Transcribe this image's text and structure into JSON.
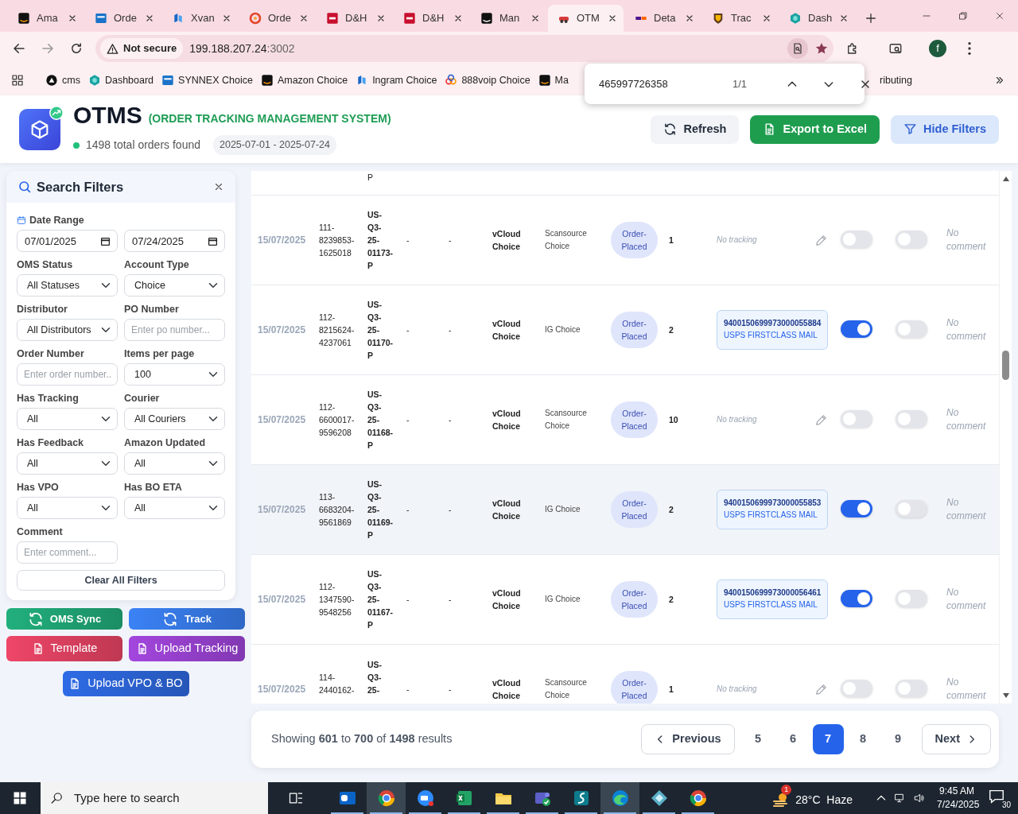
{
  "browser": {
    "tabs": [
      {
        "title": "Ama",
        "selected": false
      },
      {
        "title": "Orde",
        "selected": false
      },
      {
        "title": "Xvan",
        "selected": false
      },
      {
        "title": "Orde",
        "selected": false
      },
      {
        "title": "D&H",
        "selected": false
      },
      {
        "title": "D&H",
        "selected": false
      },
      {
        "title": "Man",
        "selected": false
      },
      {
        "title": "OTM",
        "selected": true
      },
      {
        "title": "Deta",
        "selected": false
      },
      {
        "title": "Trac",
        "selected": false
      },
      {
        "title": "Dash",
        "selected": false
      }
    ],
    "address": {
      "security": "Not secure",
      "host": "199.188.207.24",
      "port": ":3002"
    },
    "profile_initial": "f",
    "bookmarks": [
      {
        "title": "cms"
      },
      {
        "title": "Dashboard"
      },
      {
        "title": "SYNNEX Choice"
      },
      {
        "title": "Amazon Choice"
      },
      {
        "title": "Ingram Choice"
      },
      {
        "title": "888voip Choice"
      },
      {
        "title": "Ma"
      },
      {
        "title": "ributing"
      }
    ],
    "find_bar": {
      "query": "465997726358",
      "count": "1/1"
    }
  },
  "header": {
    "title": "OTMS",
    "subtitle": "(ORDER TRACKING MANAGEMENT SYSTEM)",
    "summary": "1498 total orders found",
    "date_range": "2025-07-01 - 2025-07-24",
    "buttons": [
      {
        "label": "Refresh",
        "kind": "refresh"
      },
      {
        "label": "Export to Excel",
        "kind": "export"
      },
      {
        "label": "Hide Filters",
        "kind": "filter"
      }
    ]
  },
  "filters": {
    "title": "Search Filters",
    "date_range": {
      "label": "Date Range",
      "from": "07/01/2025",
      "to": "07/24/2025"
    },
    "fields": [
      {
        "label": "OMS Status",
        "kind": "select",
        "value": "All Statuses"
      },
      {
        "label": "Account Type",
        "kind": "select",
        "value": "Choice"
      },
      {
        "label": "Distributor",
        "kind": "select",
        "value": "All Distributors"
      },
      {
        "label": "PO Number",
        "kind": "text",
        "placeholder": "Enter po number..."
      },
      {
        "label": "Order Number",
        "kind": "text",
        "placeholder": "Enter order number.."
      },
      {
        "label": "Items per page",
        "kind": "select",
        "value": "100"
      },
      {
        "label": "Has Tracking",
        "kind": "select",
        "value": "All"
      },
      {
        "label": "Courier",
        "kind": "select",
        "value": "All Couriers"
      },
      {
        "label": "Has Feedback",
        "kind": "select",
        "value": "All"
      },
      {
        "label": "Amazon Updated",
        "kind": "select",
        "value": "All"
      },
      {
        "label": "Has VPO",
        "kind": "select",
        "value": "All"
      },
      {
        "label": "Has BO ETA",
        "kind": "select",
        "value": "All"
      },
      {
        "label": "Comment",
        "kind": "text",
        "placeholder": "Enter comment..."
      }
    ],
    "clear_button": "Clear All Filters"
  },
  "actions": [
    {
      "label": "OMS Sync",
      "kind": "sync",
      "color": "#22b07d"
    },
    {
      "label": "Track",
      "kind": "sync",
      "color": "#3b82f6"
    },
    {
      "label": "Template",
      "kind": "document",
      "color": "#ef4668"
    },
    {
      "label": "Upload Tracking",
      "kind": "document",
      "color": "#a346de"
    },
    {
      "label": "Upload VPO & BO",
      "kind": "document",
      "color": "#2f6be6"
    }
  ],
  "table": {
    "rows": [
      {
        "kind": "partial",
        "column_3": "P"
      },
      {
        "kind": "full",
        "hovered": false,
        "column_1": "15/07/2025",
        "column_2": "111-8239853-1625018",
        "column_3": "US-Q3-25-01173-P",
        "column_4": "-",
        "column_5": "-",
        "column_6": "vCloud Choice",
        "column_7": "Scansource Choice",
        "column_8": "Order-Placed",
        "column_9": "1",
        "column_10": {
          "kind": "none",
          "text": "No tracking"
        },
        "column_11": {
          "on": false
        },
        "column_12": {
          "on": false
        },
        "column_13": "No comment"
      },
      {
        "kind": "full",
        "hovered": false,
        "column_1": "15/07/2025",
        "column_2": "112-8215624-4237061",
        "column_3": "US-Q3-25-01170-P",
        "column_4": "-",
        "column_5": "-",
        "column_6": "vCloud Choice",
        "column_7": "IG Choice",
        "column_8": "Order-Placed",
        "column_9": "2",
        "column_10": {
          "kind": "number",
          "number": "9400150699973000055884",
          "courier": "USPS FIRSTCLASS MAIL"
        },
        "column_11": {
          "on": true
        },
        "column_12": {
          "on": false
        },
        "column_13": "No comment"
      },
      {
        "kind": "full",
        "hovered": false,
        "column_1": "15/07/2025",
        "column_2": "112-6600017-9596208",
        "column_3": "US-Q3-25-01168-P",
        "column_4": "-",
        "column_5": "-",
        "column_6": "vCloud Choice",
        "column_7": "Scansource Choice",
        "column_8": "Order-Placed",
        "column_9": "10",
        "column_10": {
          "kind": "none",
          "text": "No tracking"
        },
        "column_11": {
          "on": false
        },
        "column_12": {
          "on": false
        },
        "column_13": "No comment"
      },
      {
        "kind": "full",
        "hovered": true,
        "column_1": "15/07/2025",
        "column_2": "113-6683204-9561869",
        "column_3": "US-Q3-25-01169-P",
        "column_4": "-",
        "column_5": "-",
        "column_6": "vCloud Choice",
        "column_7": "IG Choice",
        "column_8": "Order-Placed",
        "column_9": "2",
        "column_10": {
          "kind": "number",
          "number": "9400150699973000055853",
          "courier": "USPS FIRSTCLASS MAIL"
        },
        "column_11": {
          "on": true
        },
        "column_12": {
          "on": false
        },
        "column_13": "No comment"
      },
      {
        "kind": "full",
        "hovered": false,
        "column_1": "15/07/2025",
        "column_2": "112-1347590-9548256",
        "column_3": "US-Q3-25-01167-P",
        "column_4": "-",
        "column_5": "-",
        "column_6": "vCloud Choice",
        "column_7": "IG Choice",
        "column_8": "Order-Placed",
        "column_9": "2",
        "column_10": {
          "kind": "number",
          "number": "9400150699973000056461",
          "courier": "USPS FIRSTCLASS MAIL"
        },
        "column_11": {
          "on": true
        },
        "column_12": {
          "on": false
        },
        "column_13": "No comment"
      },
      {
        "kind": "full",
        "hovered": false,
        "column_1": "15/07/2025",
        "column_2": "114-2440162-",
        "column_3": "US-Q3-25-",
        "column_4": "-",
        "column_5": "-",
        "column_6": "vCloud Choice",
        "column_7": "Scansource Choice",
        "column_8": "Order-Placed",
        "column_9": "1",
        "column_10": {
          "kind": "none",
          "text": "No tracking"
        },
        "column_11": {
          "on": false
        },
        "column_12": {
          "on": false
        },
        "column_13": "No comment"
      }
    ]
  },
  "pagination": {
    "summary": "Showing **601** to **700** of **1498** results",
    "previous": "Previous",
    "next": "Next",
    "pages": [
      {
        "label": "5",
        "selected": false
      },
      {
        "label": "6",
        "selected": false
      },
      {
        "label": "7",
        "selected": true
      },
      {
        "label": "8",
        "selected": false
      },
      {
        "label": "9",
        "selected": false
      }
    ]
  },
  "taskbar": {
    "search_placeholder": "Type here to search",
    "weather": "28°C  Haze",
    "weather_badge": "1",
    "time": "9:45 AM",
    "date": "7/24/2025",
    "notifications": "30",
    "apps": [
      {
        "selected": false
      },
      {
        "selected": true
      },
      {
        "selected": false
      },
      {
        "selected": false
      },
      {
        "selected": false
      },
      {
        "selected": false
      },
      {
        "selected": false
      },
      {
        "selected": true
      },
      {
        "selected": false
      },
      {
        "selected": false
      }
    ]
  }
}
